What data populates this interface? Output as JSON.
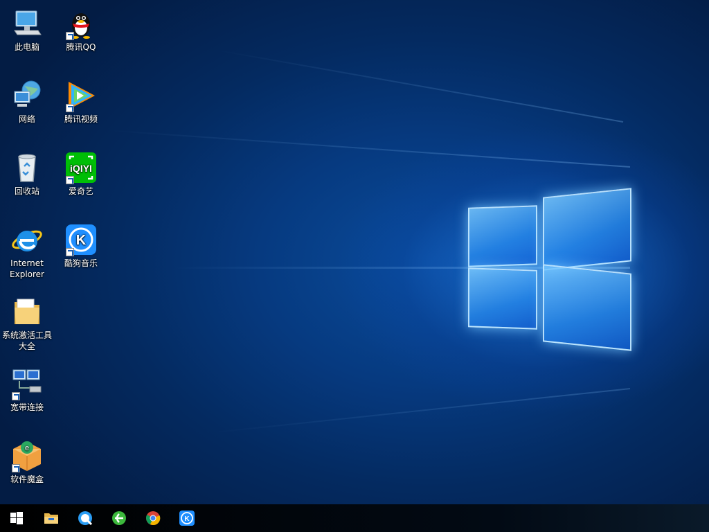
{
  "desktop": {
    "icons": [
      {
        "id": "this-pc",
        "label": "此电脑"
      },
      {
        "id": "network",
        "label": "网络"
      },
      {
        "id": "recycle-bin",
        "label": "回收站"
      },
      {
        "id": "internet-explorer",
        "label": "Internet Explorer"
      },
      {
        "id": "activation-tools",
        "label": "系统激活工具大全"
      },
      {
        "id": "broadband",
        "label": "宽带连接"
      },
      {
        "id": "software-box",
        "label": "软件魔盒"
      },
      {
        "id": "tencent-qq",
        "label": "腾讯QQ"
      },
      {
        "id": "tencent-video",
        "label": "腾讯视频"
      },
      {
        "id": "iqiyi",
        "label": "爱奇艺"
      },
      {
        "id": "kugou-music",
        "label": "酷狗音乐"
      }
    ]
  },
  "taskbar": {
    "items": [
      {
        "id": "start",
        "icon": "windows-logo-icon"
      },
      {
        "id": "file-explorer",
        "icon": "folder-icon"
      },
      {
        "id": "qq-browser",
        "icon": "qq-browser-icon"
      },
      {
        "id": "ie-green",
        "icon": "browser-green-icon"
      },
      {
        "id": "chrome",
        "icon": "chrome-icon"
      },
      {
        "id": "kugou",
        "icon": "kugou-icon"
      }
    ]
  },
  "colors": {
    "background": "#063a80",
    "logo_glow": "#78c8ff",
    "taskbar": "#000000"
  }
}
